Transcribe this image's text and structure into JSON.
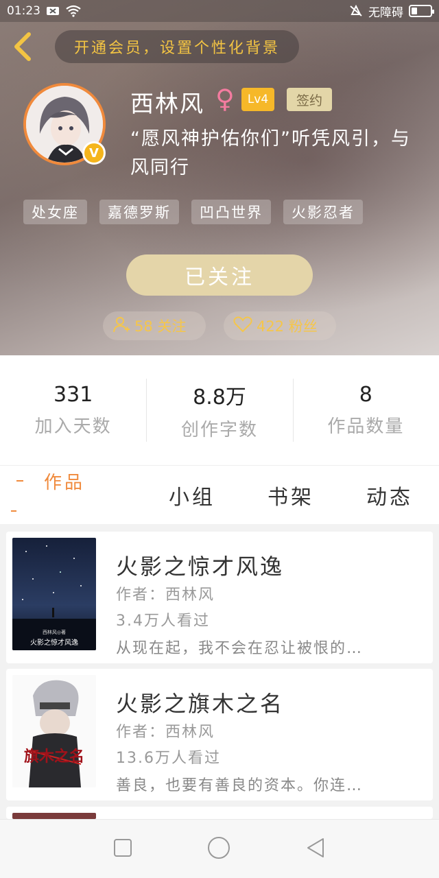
{
  "status_bar": {
    "time": "01:23",
    "accessibility_label": "无障碍",
    "battery_level": 0.3
  },
  "header": {
    "vip_banner": "开通会员，设置个性化背景",
    "username": "西林风",
    "gender_symbol": "♀",
    "level": "Lv4",
    "sign_badge": "签约",
    "motto": "“愿风神护佑你们”听凭风引，与风同行",
    "verified_badge": "V",
    "tags": [
      "处女座",
      "嘉德罗斯",
      "凹凸世界",
      "火影忍者"
    ],
    "follow_button": "已关注",
    "following_count_label": "58 关注",
    "fans_count_label": "422 粉丝"
  },
  "stats": [
    {
      "value": "331",
      "label": "加入天数"
    },
    {
      "value": "8.8万",
      "label": "创作字数"
    },
    {
      "value": "8",
      "label": "作品数量"
    }
  ],
  "tabs": [
    "作品",
    "小组",
    "书架",
    "动态"
  ],
  "books": [
    {
      "title": "火影之惊才风逸",
      "author": "作者：西林风",
      "views": "3.4万人看过",
      "desc": "从现在起，我不会在忍让被恨的…",
      "cover_title": "火影之惊才风逸",
      "cover_author": "西林风◎著"
    },
    {
      "title": "火影之旗木之名",
      "author": "作者：西林风",
      "views": "13.6万人看过",
      "desc": "善良，也要有善良的资本。你连…",
      "cover_title": "旗木之名"
    }
  ],
  "colors": {
    "accent_orange": "#f08a3c",
    "vip_gold": "#f3c443",
    "level_badge": "#f6b829",
    "follow_button": "#e4d5a9"
  }
}
